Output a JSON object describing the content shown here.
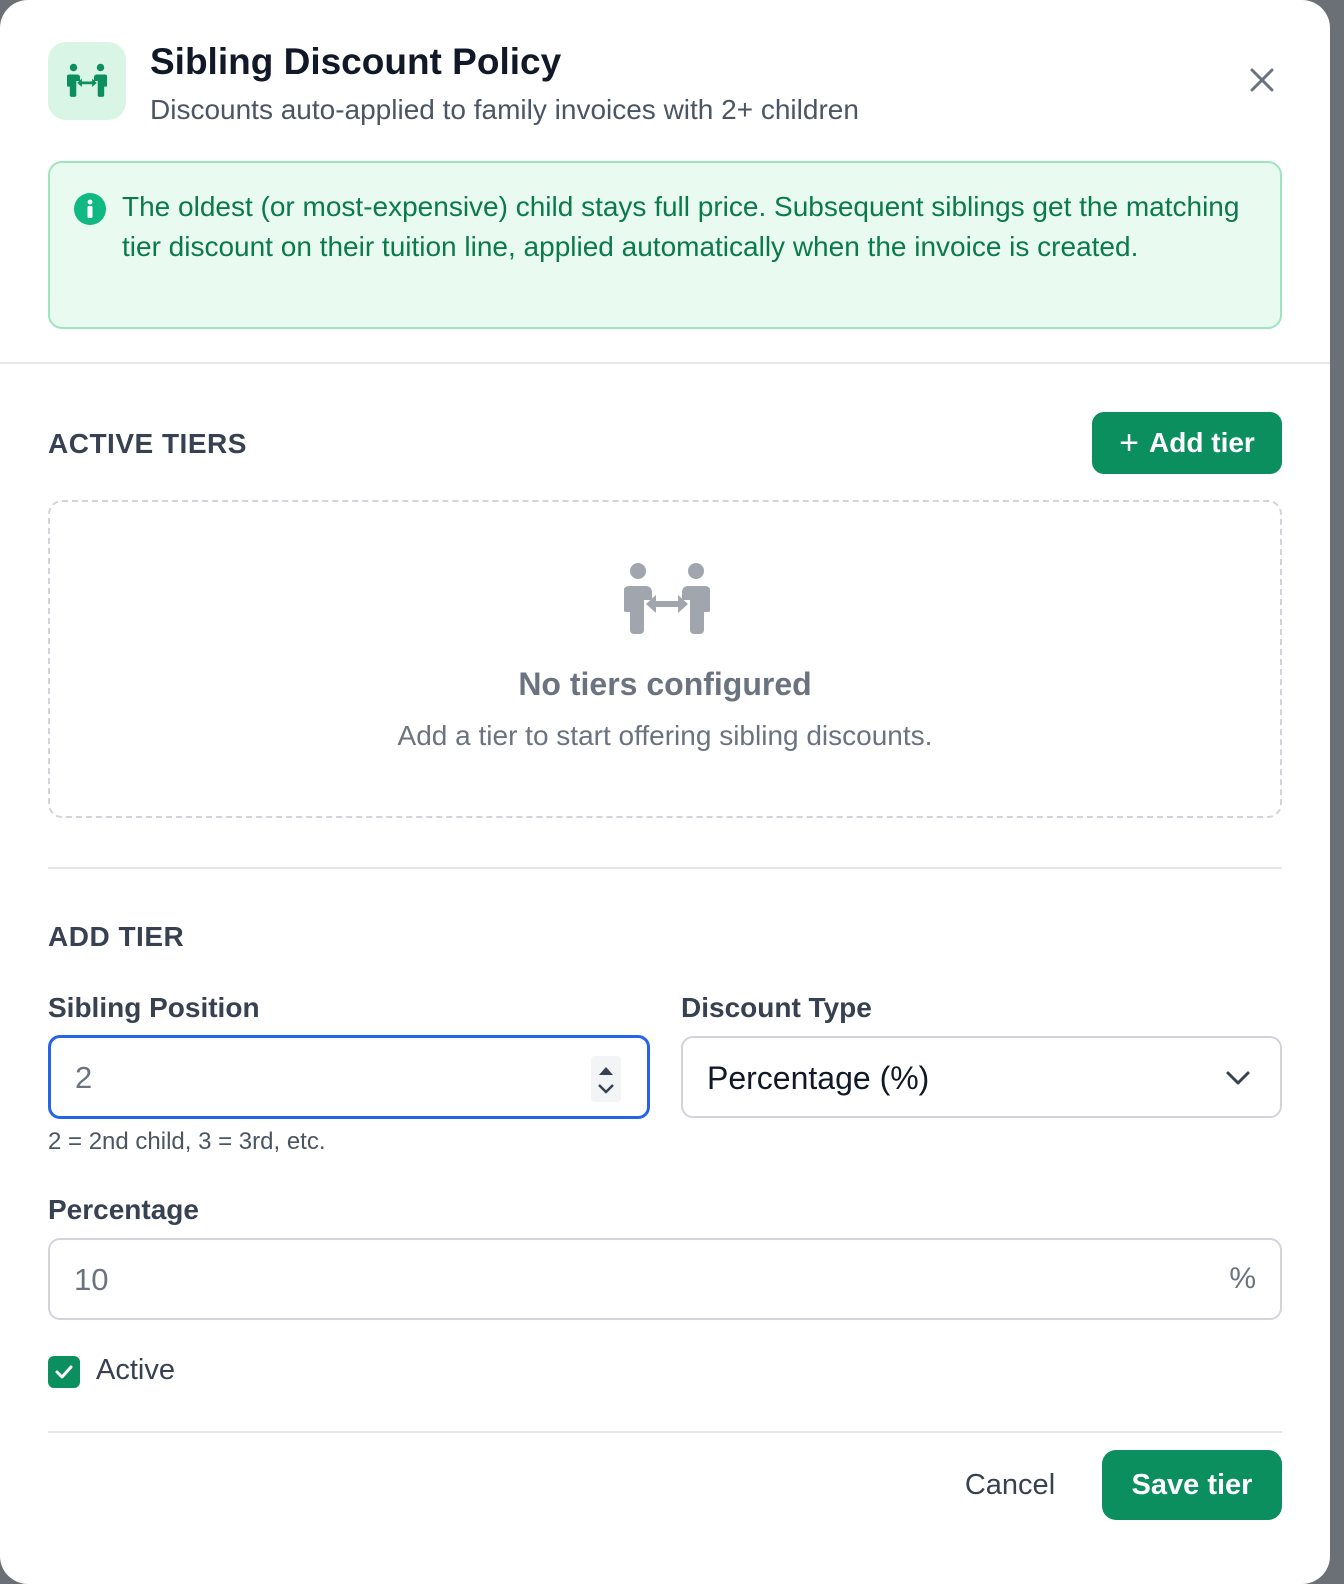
{
  "dialog": {
    "title": "Sibling Discount Policy",
    "subtitle": "Discounts auto-applied to family invoices with 2+ children",
    "icon": "sibling-exchange-icon",
    "close_icon": "close-icon"
  },
  "info_banner": {
    "icon": "info-icon",
    "text": "The oldest (or most-expensive) child stays full price. Subsequent siblings get the matching tier discount on their tuition line, applied automatically when the invoice is created."
  },
  "active_tiers": {
    "heading": "ACTIVE TIERS",
    "add_button_icon": "plus-icon",
    "add_button_label": "Add tier",
    "empty_state": {
      "icon": "sibling-exchange-icon",
      "title": "No tiers configured",
      "subtitle": "Add a tier to start offering sibling discounts."
    }
  },
  "add_tier": {
    "heading": "ADD TIER",
    "sibling_position": {
      "label": "Sibling Position",
      "value": "2",
      "hint": "2 = 2nd child, 3 = 3rd, etc."
    },
    "discount_type": {
      "label": "Discount Type",
      "selected": "Percentage (%)"
    },
    "percentage": {
      "label": "Percentage",
      "value": "10",
      "suffix": "%"
    },
    "active": {
      "label": "Active",
      "checked": true
    }
  },
  "footer": {
    "cancel_label": "Cancel",
    "save_label": "Save tier"
  },
  "colors": {
    "accent": "#0b8f5f",
    "focus": "#2563eb",
    "info_bg": "#e9fbf1",
    "info_text": "#0b7a4b"
  }
}
